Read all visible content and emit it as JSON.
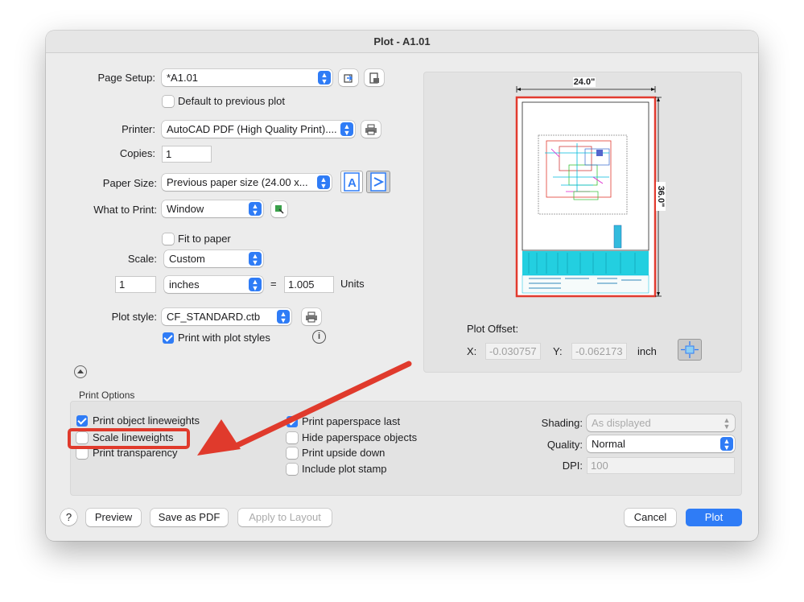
{
  "window": {
    "title": "Plot - A1.01"
  },
  "page_setup": {
    "label": "Page Setup:",
    "value": "*A1.01",
    "default_checkbox": "Default to previous plot",
    "default_checked": false
  },
  "printer": {
    "label": "Printer:",
    "value": "AutoCAD PDF (High Quality Print)...."
  },
  "copies": {
    "label": "Copies:",
    "value": "1"
  },
  "paper_size": {
    "label": "Paper Size:",
    "value": "Previous paper size (24.00 x..."
  },
  "what_to_print": {
    "label": "What to Print:",
    "value": "Window"
  },
  "scale": {
    "fit_label": "Fit to paper",
    "fit_checked": false,
    "label": "Scale:",
    "value": "Custom",
    "numerator": "1",
    "unit": "inches",
    "equals": "=",
    "denominator": "1.005",
    "units_label": "Units"
  },
  "plot_style": {
    "label": "Plot style:",
    "value": "CF_STANDARD.ctb",
    "print_with_label": "Print with plot styles",
    "print_with_checked": true
  },
  "preview": {
    "width_dim": "24.0\"",
    "height_dim": "36.0\""
  },
  "plot_offset": {
    "label": "Plot Offset:",
    "x_label": "X:",
    "x_value": "-0.030757",
    "y_label": "Y:",
    "y_value": "-0.062173",
    "unit": "inch"
  },
  "print_options": {
    "heading": "Print Options",
    "col1": [
      {
        "label": "Print object lineweights",
        "checked": true
      },
      {
        "label": "Scale lineweights",
        "checked": false
      },
      {
        "label": "Print transparency",
        "checked": false
      }
    ],
    "col2": [
      {
        "label": "Print paperspace last",
        "checked": true
      },
      {
        "label": "Hide paperspace objects",
        "checked": false
      },
      {
        "label": "Print upside down",
        "checked": false
      },
      {
        "label": "Include plot stamp",
        "checked": false
      }
    ],
    "shading_label": "Shading:",
    "shading_value": "As displayed",
    "quality_label": "Quality:",
    "quality_value": "Normal",
    "dpi_label": "DPI:",
    "dpi_value": "100"
  },
  "footer": {
    "help": "?",
    "preview": "Preview",
    "save_pdf": "Save as PDF",
    "apply_layout": "Apply to Layout",
    "cancel": "Cancel",
    "plot": "Plot"
  },
  "colors": {
    "accent": "#2f7cf6",
    "annotation": "#e03a2c",
    "paper_border": "#e23b2f"
  }
}
